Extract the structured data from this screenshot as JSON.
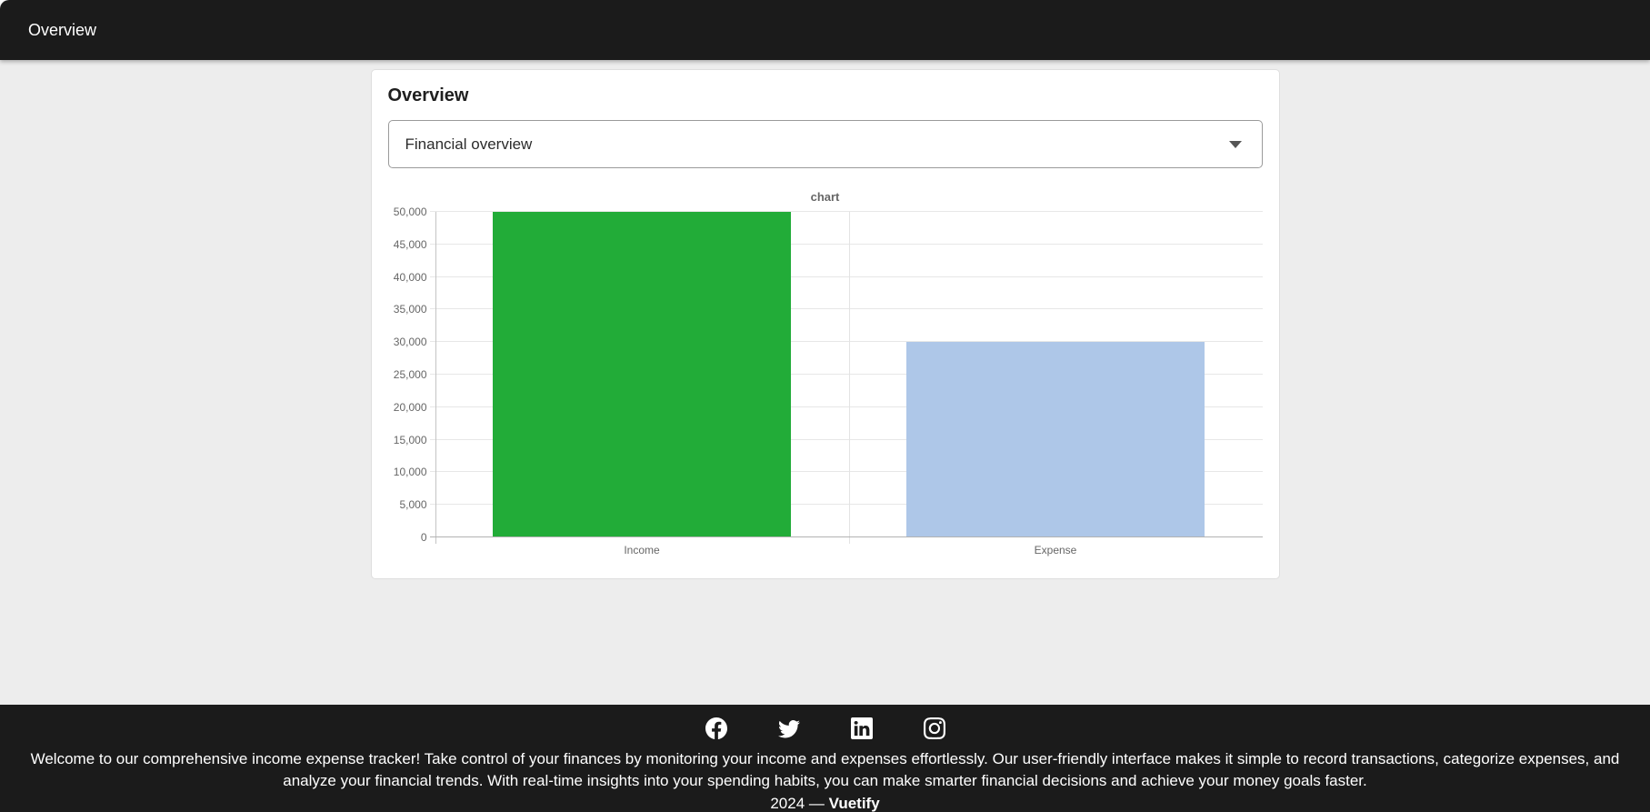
{
  "app_bar": {
    "title": "Overview"
  },
  "card": {
    "title": "Overview",
    "select": {
      "value": "Financial overview"
    }
  },
  "chart_data": {
    "type": "bar",
    "title": "chart",
    "categories": [
      "Income",
      "Expense"
    ],
    "values": [
      50000,
      30000
    ],
    "colors": [
      "#22ac38",
      "#aec7e8"
    ],
    "xlabel": "",
    "ylabel": "",
    "ylim": [
      0,
      50000
    ],
    "ytick_step": 5000,
    "ytick_labels": [
      "0",
      "5,000",
      "10,000",
      "15,000",
      "20,000",
      "25,000",
      "30,000",
      "35,000",
      "40,000",
      "45,000",
      "50,000"
    ],
    "grid": true,
    "legend_position": "none",
    "bar_width_fraction": 0.72
  },
  "footer": {
    "social_icons": [
      "facebook",
      "twitter",
      "linkedin",
      "instagram"
    ],
    "description": "Welcome to our comprehensive income expense tracker! Take control of your finances by monitoring your income and expenses effortlessly. Our user-friendly interface makes it simple to record transactions, categorize expenses, and analyze your financial trends. With real-time insights into your spending habits, you can make smarter financial decisions and achieve your money goals faster.",
    "copyright_prefix": "2024 — ",
    "brand": "Vuetify"
  },
  "theme": {
    "app_bar_bg": "#1b1b1b",
    "footer_bg": "#1b1b1b",
    "page_bg": "#ededed",
    "card_bg": "#ffffff"
  }
}
